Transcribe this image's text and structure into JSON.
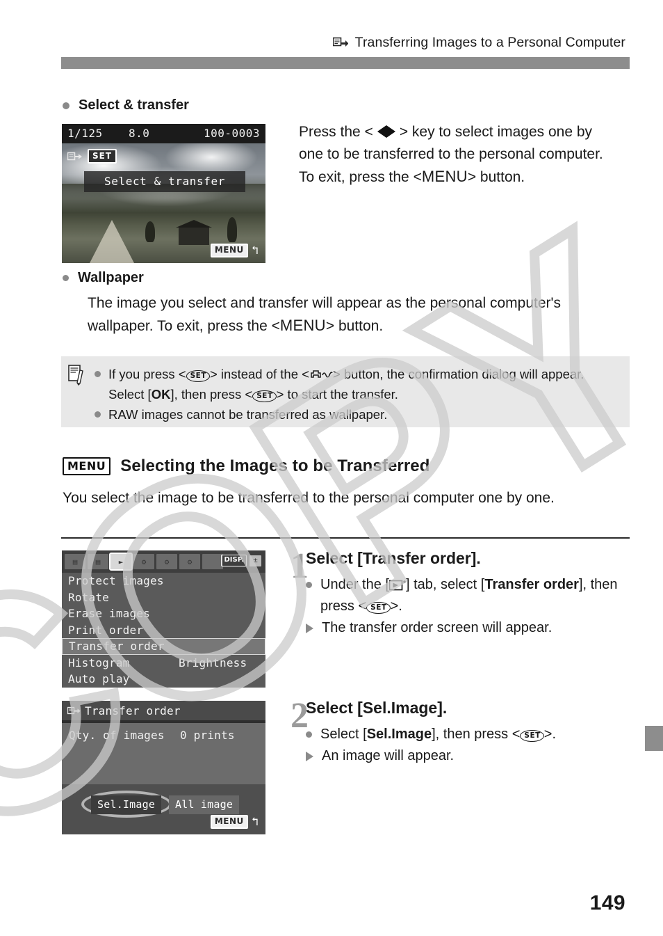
{
  "header": {
    "icon": "transfer-to-computer-icon",
    "title": "Transferring Images to a Personal Computer"
  },
  "sections": {
    "select_transfer": {
      "heading": "Select & transfer",
      "paragraph_1": "Press the <",
      "paragraph_2": "> key to select images one by one to be transferred to the personal computer. To exit, press the <",
      "menu_word": "MENU",
      "paragraph_3": "> button.",
      "lcd": {
        "shutter_speed": "1/125",
        "aperture": "8.0",
        "file_number": "100-0003",
        "set_badge": "SET",
        "banner_label": "Select & transfer",
        "menu_badge": "MENU",
        "return_arrow": "↰"
      }
    },
    "wallpaper": {
      "heading": "Wallpaper",
      "paragraph_1": "The image you select and transfer will appear as the personal computer's wallpaper. To exit, press the <",
      "menu_word": "MENU",
      "paragraph_2": "> button."
    }
  },
  "note_box": {
    "icon": "note-pencil-icon",
    "items": [
      {
        "part_1": "If you press <",
        "set_icon": "SET",
        "part_2": "> instead of the <",
        "print_icon": "print-share-icon",
        "part_3": "> button, the confirmation dialog will appear. Select [",
        "ok_label": "OK",
        "part_4": "], then press <",
        "set_icon_2": "SET",
        "part_5": "> to start the transfer."
      },
      {
        "text": "RAW images cannot be transferred as wallpaper."
      }
    ]
  },
  "menu_section": {
    "badge": "MENU",
    "title": "Selecting the Images to be Transferred",
    "intro": "You select the image to be transferred to the personal computer one by one."
  },
  "steps": [
    {
      "number": "1",
      "title": "Select [Transfer order].",
      "bullet_part_1": "Under the [",
      "tab_icon": "playback-tab-2-icon",
      "bullet_part_2": "] tab, select [",
      "bold_1": "Transfer order",
      "bullet_part_3": "], then press <",
      "set_icon": "SET",
      "bullet_part_4": ">.",
      "result": "The transfer order screen will appear.",
      "lcd": {
        "tabs": [
          "shoot-1-tab",
          "shoot-2-tab",
          "playback-2-tab",
          "setup-1-tab",
          "setup-2-tab",
          "setup-3-tab",
          "custom-tab"
        ],
        "selected_tab_index": 2,
        "disp_badge": "DISP.",
        "disp_square": "±",
        "rows": [
          {
            "label": "Protect images",
            "value": "",
            "highlight": false
          },
          {
            "label": "Rotate",
            "value": "",
            "highlight": false
          },
          {
            "label": "Erase images",
            "value": "",
            "highlight": false
          },
          {
            "label": "Print order",
            "value": "",
            "highlight": false
          },
          {
            "label": "Transfer order",
            "value": "",
            "highlight": true
          },
          {
            "label": "Histogram",
            "value": "Brightness",
            "highlight": false
          },
          {
            "label": "Auto play",
            "value": "",
            "highlight": false
          }
        ]
      }
    },
    {
      "number": "2",
      "title": "Select [Sel.Image].",
      "bullet_part_1": "Select [",
      "bold_1": "Sel.Image",
      "bullet_part_2": "], then press <",
      "set_icon": "SET",
      "bullet_part_3": ">.",
      "result": "An image will appear.",
      "lcd": {
        "title": "Transfer order",
        "title_icon": "transfer-order-icon",
        "qty_label": "Qty. of images",
        "qty_value": "0 prints",
        "button_selected": "Sel.Image",
        "button_other": "All image",
        "menu_badge": "MENU",
        "return_arrow": "↰"
      }
    }
  ],
  "page_number": "149",
  "watermark": "COPY"
}
